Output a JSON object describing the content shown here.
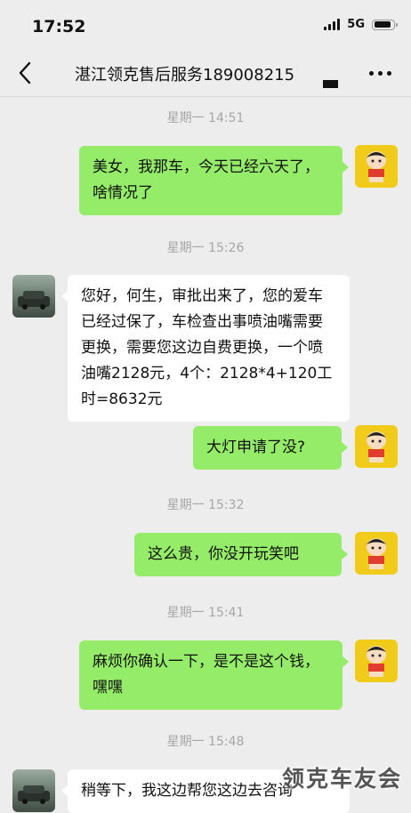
{
  "status_bar": {
    "time": "17:52",
    "network": "5G",
    "battery_level": 0.9
  },
  "header": {
    "title": "湛江领克售后服务189008215"
  },
  "messages": [
    {
      "time": "星期一 14:51",
      "text": "美女，我那车，今天已经六天了，啥情况了",
      "direction": "outgoing"
    },
    {
      "time": "星期一 15:26",
      "text": "您好，何生，审批出来了，您的爱车已经过保了，车检查出事喷油嘴需要更换，需要您这边自费更换，一个喷油嘴2128元，4个：2128*4+120工时=8632元",
      "direction": "incoming"
    },
    {
      "text": "大灯申请了没?",
      "direction": "outgoing"
    },
    {
      "time": "星期一 15:32",
      "text": "这么贵，你没开玩笑吧",
      "direction": "outgoing"
    },
    {
      "time": "星期一 15:41",
      "text": "麻烦你确认一下，是不是这个钱，嘿嘿",
      "direction": "outgoing"
    },
    {
      "time": "星期一 15:48",
      "text": "稍等下，我这边帮您这边去咨询",
      "direction": "incoming"
    }
  ],
  "watermark": "领克车友会",
  "colors": {
    "outgoing_bubble": "#95ec69",
    "incoming_bubble": "#ffffff",
    "background": "#ededed",
    "timestamp": "#a6a6a6"
  }
}
